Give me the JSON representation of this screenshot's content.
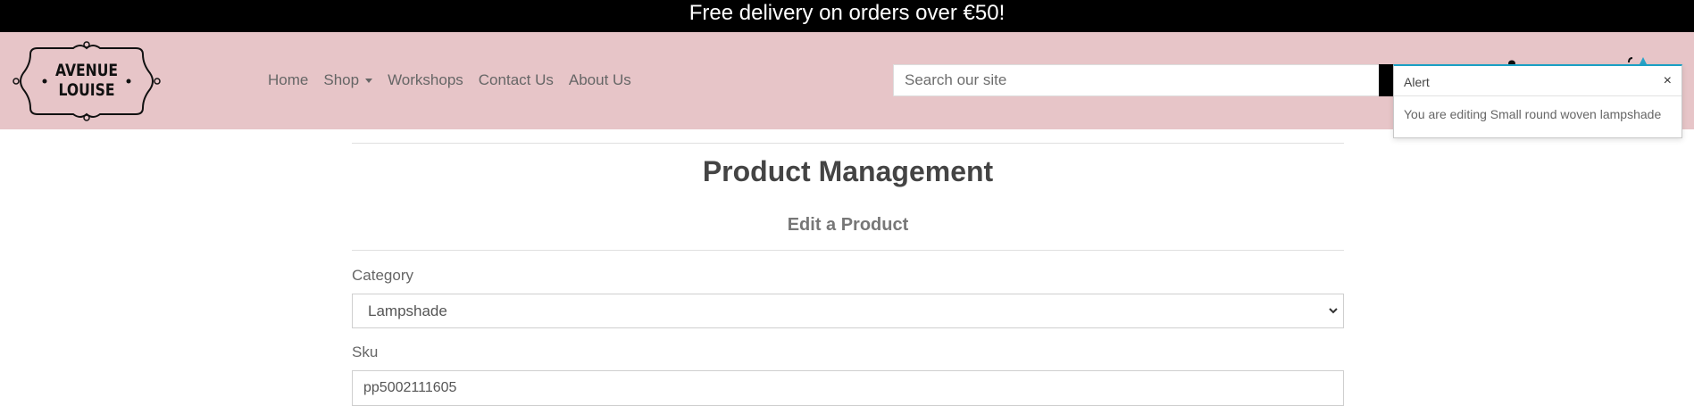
{
  "promo": {
    "text": "Free delivery on orders over €50!"
  },
  "logo": {
    "line1": "AVENUE",
    "line2": "LOUISE"
  },
  "nav": {
    "items": [
      {
        "label": "Home"
      },
      {
        "label": "Shop"
      },
      {
        "label": "Workshops"
      },
      {
        "label": "Contact Us"
      },
      {
        "label": "About Us"
      }
    ]
  },
  "search": {
    "placeholder": "Search our site",
    "value": ""
  },
  "toast": {
    "title": "Alert",
    "close": "×",
    "message": "You are editing Small round woven lampshade"
  },
  "main": {
    "title": "Product Management",
    "subtitle": "Edit a Product",
    "category_label": "Category",
    "category_value": "Lampshade",
    "sku_label": "Sku",
    "sku_value": "pp5002111605"
  },
  "colors": {
    "header_bg": "#e7c5c8",
    "promo_bg": "#000000",
    "toast_accent": "#1aa0c4"
  }
}
